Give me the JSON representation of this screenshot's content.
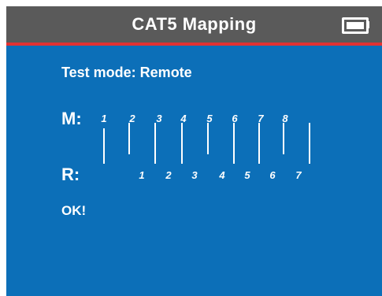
{
  "header": {
    "title": "CAT5  Mapping",
    "battery_icon": "battery-icon"
  },
  "test": {
    "mode_label": "Test mode: Remote",
    "master_label": "M:",
    "remote_label": "R:",
    "result": "OK!"
  },
  "master_pins": [
    "1",
    "2",
    "3",
    "4",
    "5",
    "6",
    "7",
    "8"
  ],
  "remote_pins": [
    "1",
    "2",
    "3",
    "4",
    "5",
    "6",
    "7"
  ],
  "colors": {
    "screen": "#0c6fb8",
    "titlebar": "#5a5a5a",
    "accent_line": "#e23232",
    "text": "#ffffff"
  }
}
